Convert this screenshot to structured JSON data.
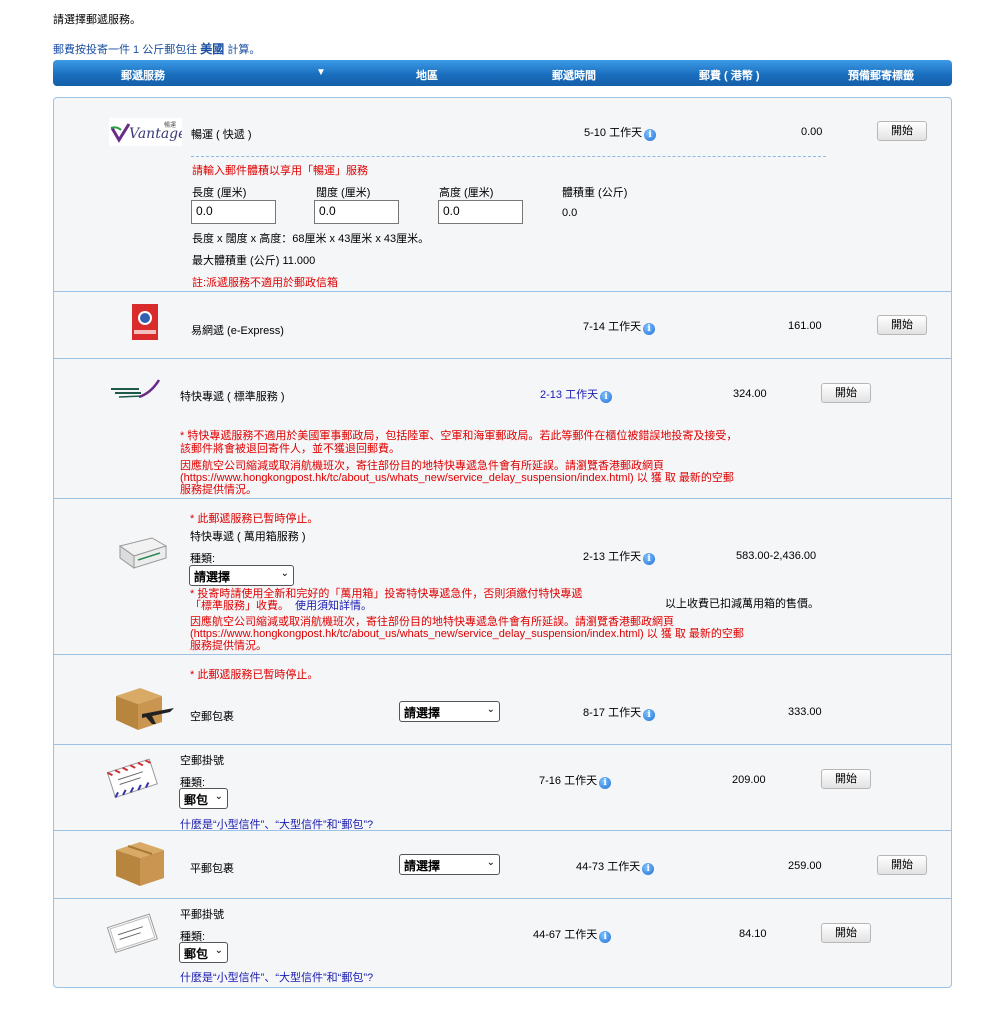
{
  "intro": {
    "line1": "請選擇郵遞服務。",
    "line2_pre": "郵費按投寄一件 1 公斤郵包往 ",
    "country": "美國",
    "line2_post": " 計算。"
  },
  "header": {
    "service": "郵遞服務",
    "arrow": "▼",
    "region": "地區",
    "time": "郵遞時間",
    "fee": "郵費 ( 港幣 )",
    "label": "預備郵寄標籤"
  },
  "rows": {
    "vantage": {
      "name": "暢運 ( 快遞 )",
      "time": "5-10 工作天",
      "fee": "0.00",
      "button": "開始",
      "logo_text": "Vantage",
      "logo_cn": "暢運",
      "note": "請輸入郵件體積以享用「暢運」服務",
      "length_label": "長度 (厘米)",
      "width_label": "闊度 (厘米)",
      "height_label": "高度 (厘米)",
      "volweight_label": "體積重 (公斤)",
      "length_value": "0.0",
      "width_value": "0.0",
      "height_value": "0.0",
      "volweight_value": "0.0",
      "dims_text": "長度 x 闊度 x 高度：68厘米 x 43厘米 x 43厘米。",
      "max_weight": "最大體積重 (公斤) 11.000",
      "remark": "註:派遞服務不適用於郵政信箱"
    },
    "eexpress": {
      "name": "易網遞 (e-Express)",
      "time": "7-14 工作天",
      "fee": "161.00",
      "button": "開始"
    },
    "speedpost_std": {
      "name": "特快專遞 ( 標準服務 )",
      "time": "2-13 工作天",
      "fee": "324.00",
      "button": "開始",
      "note1": "* 特快專遞服務不適用於美國軍事郵政局，包括陸軍、空軍和海軍郵政局。若此等郵件在櫃位被錯誤地投寄及接受，該郵件將會被退回寄件人，並不獲退回郵費。",
      "note2": "因應航空公司縮減或取消航機班次，寄往部份目的地特快專遞急件會有所延誤。請瀏覽香港郵政網頁(https://www.hongkongpost.hk/tc/about_us/whats_new/service_delay_suspension/index.html) 以 獲 取 最新的空郵服務提供情況。"
    },
    "speedpost_box": {
      "suspended": "* 此郵遞服務已暫時停止。",
      "name": "特快專遞 ( 萬用箱服務 )",
      "type_label": "種類:",
      "select": "請選擇",
      "time": "2-13 工作天",
      "fee": "583.00-2,436.00",
      "fee_note": "以上收費已扣減萬用箱的售價。",
      "note1": "* 投寄時請使用全新和完好的「萬用箱」投寄特快專遞急件，否則須繳付特快專遞「標準服務」收費。",
      "note1_link": "使用須知詳情。",
      "note2": "因應航空公司縮減或取消航機班次，寄往部份目的地特快專遞急件會有所延誤。請瀏覽香港郵政網頁(https://www.hongkongpost.hk/tc/about_us/whats_new/service_delay_suspension/index.html) 以 獲 取 最新的空郵服務提供情況。"
    },
    "air_parcel": {
      "suspended": "* 此郵遞服務已暫時停止。",
      "name": "空郵包裹",
      "select": "請選擇",
      "time": "8-17 工作天",
      "fee": "333.00"
    },
    "air_registered": {
      "name": "空郵掛號",
      "type_label": "種類:",
      "select": "郵包",
      "link": "什麼是“小型信件”、“大型信件”和“郵包”?",
      "time": "7-16 工作天",
      "fee": "209.00",
      "button": "開始"
    },
    "surface_parcel": {
      "name": "平郵包裹",
      "select": "請選擇",
      "time": "44-73 工作天",
      "fee": "259.00",
      "button": "開始"
    },
    "surface_registered": {
      "name": "平郵掛號",
      "type_label": "種類:",
      "select": "郵包",
      "link": "什麼是“小型信件”、“大型信件”和“郵包”?",
      "time": "44-67 工作天",
      "fee": "84.10",
      "button": "開始"
    }
  }
}
